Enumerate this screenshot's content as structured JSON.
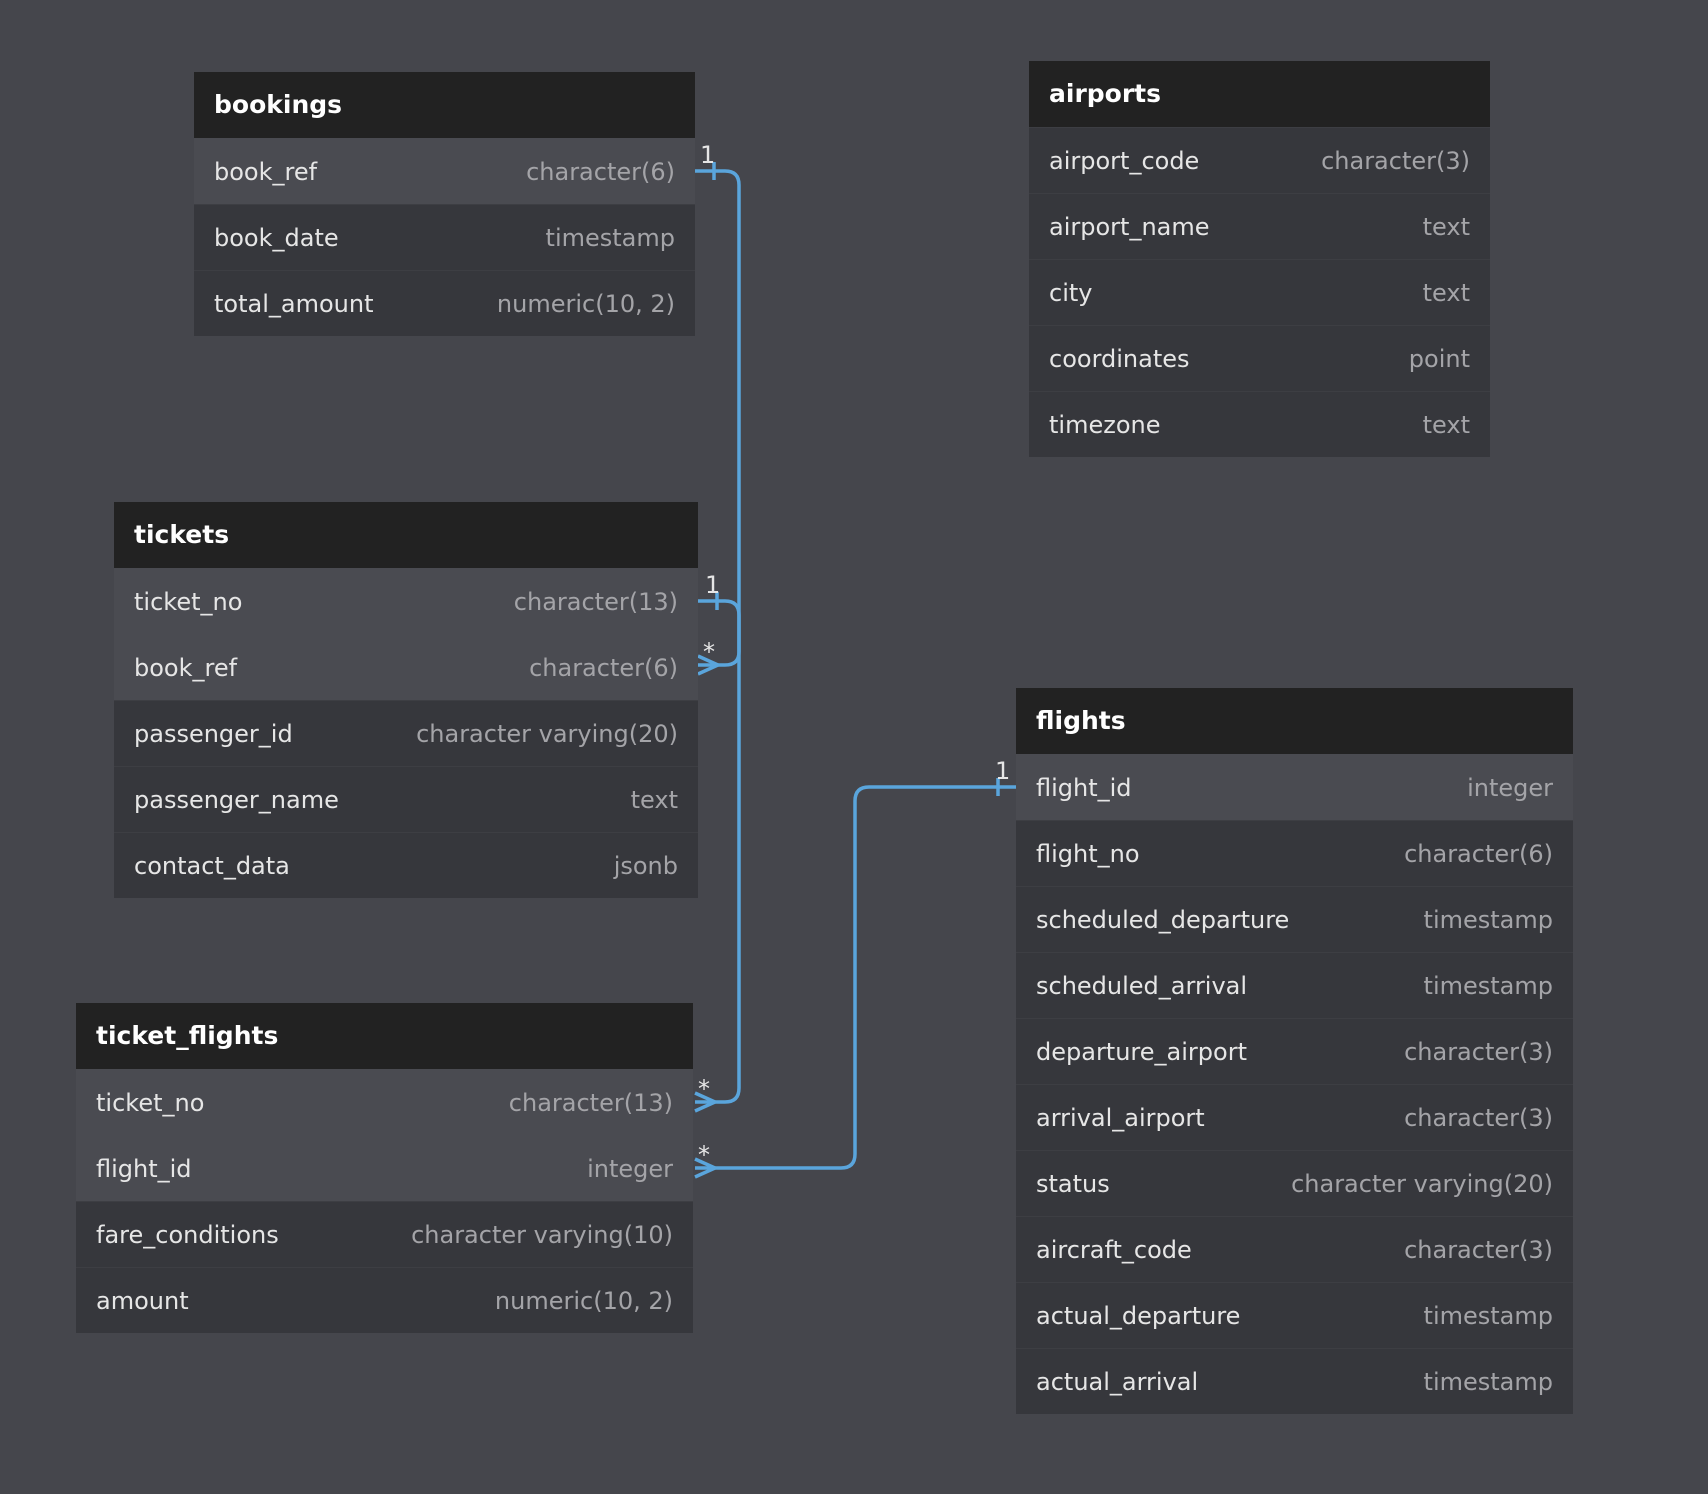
{
  "line_color": "#5aa5dc",
  "tables": {
    "bookings": {
      "name": "bookings",
      "columns": [
        {
          "name": "book_ref",
          "type": "character(6)",
          "key": true
        },
        {
          "name": "book_date",
          "type": "timestamp"
        },
        {
          "name": "total_amount",
          "type": "numeric(10, 2)"
        }
      ]
    },
    "airports": {
      "name": "airports",
      "columns": [
        {
          "name": "airport_code",
          "type": "character(3)"
        },
        {
          "name": "airport_name",
          "type": "text"
        },
        {
          "name": "city",
          "type": "text"
        },
        {
          "name": "coordinates",
          "type": "point"
        },
        {
          "name": "timezone",
          "type": "text"
        }
      ]
    },
    "tickets": {
      "name": "tickets",
      "columns": [
        {
          "name": "ticket_no",
          "type": "character(13)",
          "key": true
        },
        {
          "name": "book_ref",
          "type": "character(6)",
          "key": true
        },
        {
          "name": "passenger_id",
          "type": "character varying(20)"
        },
        {
          "name": "passenger_name",
          "type": "text"
        },
        {
          "name": "contact_data",
          "type": "jsonb"
        }
      ]
    },
    "ticket_flights": {
      "name": "ticket_flights",
      "columns": [
        {
          "name": "ticket_no",
          "type": "character(13)",
          "key": true
        },
        {
          "name": "flight_id",
          "type": "integer",
          "key": true
        },
        {
          "name": "fare_conditions",
          "type": "character varying(10)"
        },
        {
          "name": "amount",
          "type": "numeric(10, 2)"
        }
      ]
    },
    "flights": {
      "name": "flights",
      "columns": [
        {
          "name": "flight_id",
          "type": "integer",
          "key": true
        },
        {
          "name": "flight_no",
          "type": "character(6)"
        },
        {
          "name": "scheduled_departure",
          "type": "timestamp"
        },
        {
          "name": "scheduled_arrival",
          "type": "timestamp"
        },
        {
          "name": "departure_airport",
          "type": "character(3)"
        },
        {
          "name": "arrival_airport",
          "type": "character(3)"
        },
        {
          "name": "status",
          "type": "character varying(20)"
        },
        {
          "name": "aircraft_code",
          "type": "character(3)"
        },
        {
          "name": "actual_departure",
          "type": "timestamp"
        },
        {
          "name": "actual_arrival",
          "type": "timestamp"
        }
      ]
    }
  },
  "relations": {
    "bookings_tickets": {
      "from": "1",
      "to": "*"
    },
    "tickets_ticket_flights": {
      "from": "1",
      "to": "*"
    },
    "flights_ticket_flights": {
      "from": "1",
      "to": "*"
    }
  }
}
